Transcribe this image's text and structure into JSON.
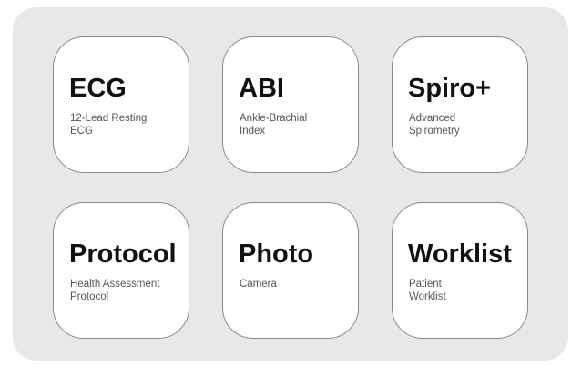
{
  "colors": {
    "panel_background": "#e8e8e8",
    "tile_background": "#ffffff",
    "tile_border": "#8a8a8a",
    "title_text": "#111111",
    "subtitle_text": "#555555"
  },
  "tiles": [
    {
      "title": "ECG",
      "subtitle": [
        "12-Lead Resting",
        "ECG"
      ]
    },
    {
      "title": "ABI",
      "subtitle": [
        "Ankle-Brachial",
        "Index"
      ]
    },
    {
      "title": "Spiro+",
      "subtitle": [
        "Advanced",
        "Spirometry"
      ]
    },
    {
      "title": "Protocol",
      "subtitle": [
        "Health Assessment",
        "Protocol"
      ]
    },
    {
      "title": "Photo",
      "subtitle": [
        "Camera"
      ]
    },
    {
      "title": "Worklist",
      "subtitle": [
        "Patient",
        "Worklist"
      ]
    }
  ]
}
